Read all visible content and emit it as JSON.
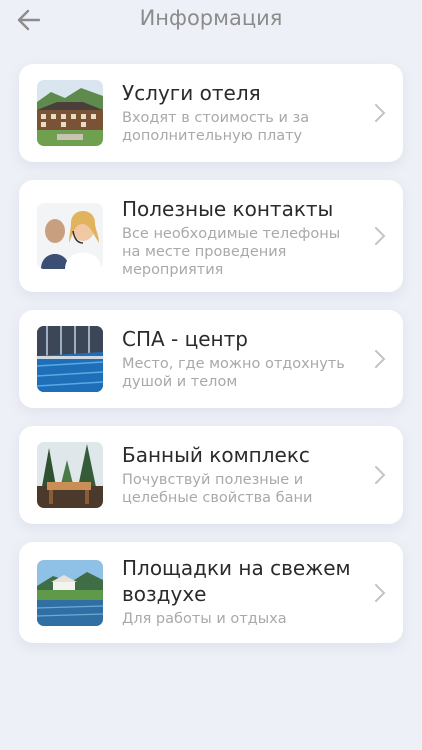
{
  "header": {
    "title": "Информация",
    "back_icon": "arrow-left-icon"
  },
  "colors": {
    "background": "#eef0f7",
    "card": "#ffffff",
    "title_text": "#2b2b2b",
    "desc_text": "#a9a9a9",
    "header_text": "#8c8c8c"
  },
  "items": [
    {
      "title": "Услуги отеля",
      "description": "Входят в стоимость и за дополнительную плату",
      "image": "hotel-building-photo",
      "icon": "chevron-right-icon"
    },
    {
      "title": "Полезные контакты",
      "description": "Все необходимые телефоны на месте проведения мероприятия",
      "image": "call-center-operators-photo",
      "icon": "chevron-right-icon"
    },
    {
      "title": "СПА - центр",
      "description": "Место, где можно отдохнуть душой и телом",
      "image": "indoor-pool-photo",
      "icon": "chevron-right-icon"
    },
    {
      "title": "Банный комплекс",
      "description": "Почувствуй полезные и целебные свойства бани",
      "image": "forest-sauna-photo",
      "icon": "chevron-right-icon"
    },
    {
      "title": "Площадки на свежем воздухе",
      "description": "Для работы и отдыха",
      "image": "lakeside-venue-photo",
      "icon": "chevron-right-icon"
    }
  ]
}
